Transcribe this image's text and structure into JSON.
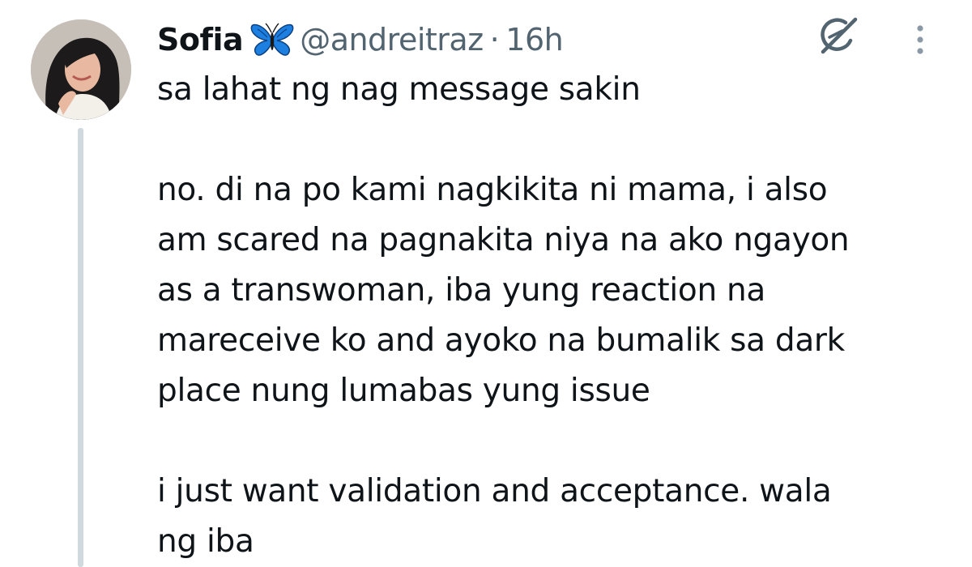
{
  "author": {
    "display_name": "Sofia",
    "emoji_icon": "butterfly-icon",
    "handle": "@andreitraz",
    "separator": "·",
    "timestamp": "16h"
  },
  "actions": {
    "grok_icon": "grok-icon",
    "more_icon": "more-vertical-icon"
  },
  "tweet": {
    "line_1": "sa lahat ng nag message sakin",
    "line_2": "no. di na po kami nagkikita ni mama, i also",
    "line_3": "am scared na pagnakita niya na ako ngayon",
    "line_4": "as a transwoman, iba yung reaction na",
    "line_5": "mareceive ko and ayoko na bumalik sa dark",
    "line_6": "place nung lumabas yung issue",
    "line_7": "i just want validation and acceptance. wala",
    "line_8": "ng iba"
  },
  "colors": {
    "text_primary": "#0f1419",
    "text_secondary": "#536471",
    "thread_line": "#cfd9de",
    "butterfly_blue": "#1d7fe0"
  }
}
